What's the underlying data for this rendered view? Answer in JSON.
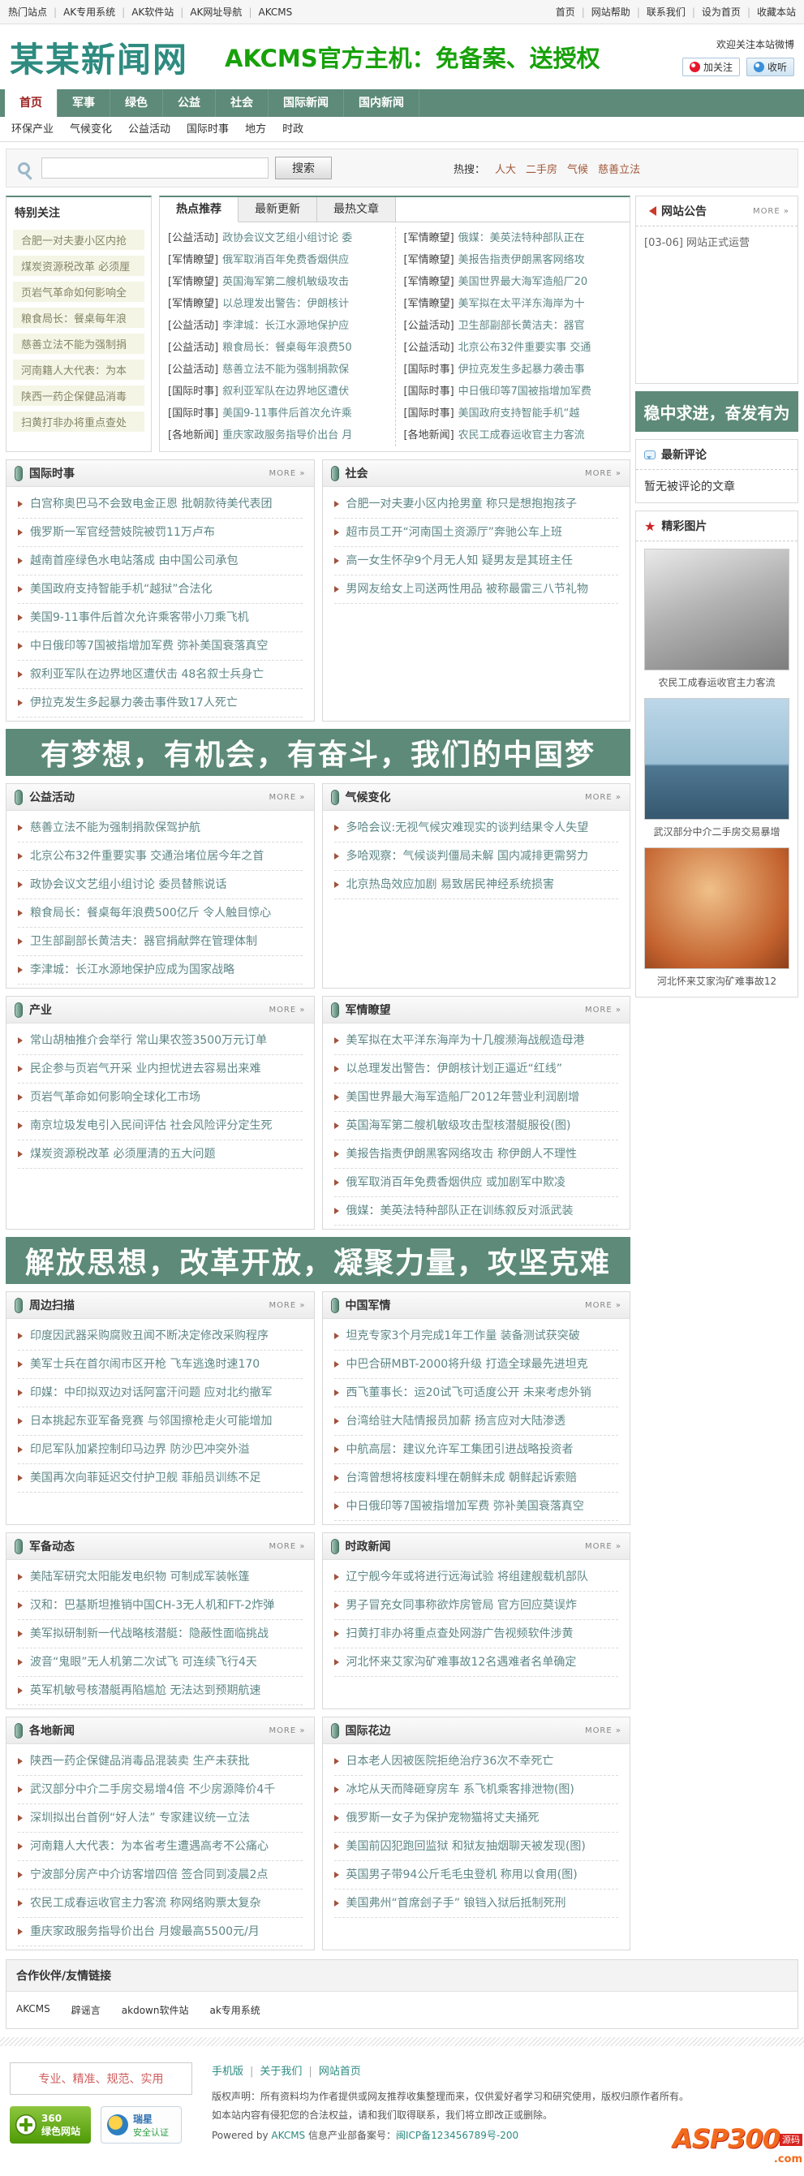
{
  "theme": {
    "accent_green": "#5d8a79",
    "link_teal": "#5e8787",
    "active_red": "#9c1f1f",
    "logo_teal": "#2e8b80",
    "promo_green": "#17a10a"
  },
  "more_label": "MORE »",
  "topbar": {
    "left_links": [
      "热门站点",
      "AK专用系统",
      "AK软件站",
      "AK网址导航",
      "AKCMS"
    ],
    "right_links": [
      "首页",
      "网站帮助",
      "联系我们",
      "设为首页",
      "收藏本站"
    ]
  },
  "header": {
    "site_name": "某某新闻网",
    "promo": "AKCMS官方主机：免备案、送授权",
    "weibo_note": "欢迎关注本站微博",
    "follow_label": "加关注",
    "listen_label": "收听"
  },
  "nav": {
    "items": [
      "首页",
      "军事",
      "绿色",
      "公益",
      "社会",
      "国际新闻",
      "国内新闻"
    ]
  },
  "subnav": {
    "items": [
      "环保产业",
      "气候变化",
      "公益活动",
      "国际时事",
      "地方",
      "时政"
    ]
  },
  "search": {
    "button": "搜索",
    "hot_label": "热搜：",
    "hot_links": [
      "人大",
      "二手房",
      "气候",
      "慈善立法"
    ]
  },
  "special": {
    "title": "特别关注",
    "items": [
      "合肥一对夫妻小区内抢",
      "煤炭资源税改革 必须厘",
      "页岩气革命如何影响全",
      "粮食局长：餐桌每年浪",
      "慈善立法不能为强制捐",
      "河南籍人大代表：为本",
      "陕西一药企保健品消毒",
      "扫黄打非办将重点查处"
    ]
  },
  "tabs": {
    "labels": [
      "热点推荐",
      "最新更新",
      "最热文章"
    ],
    "left": [
      {
        "tag": "[公益活动]",
        "title": "政协会议文艺组小组讨论 委"
      },
      {
        "tag": "[军情瞭望]",
        "title": "俄军取消百年免费香烟供应"
      },
      {
        "tag": "[军情瞭望]",
        "title": "英国海军第二艘机敏级攻击"
      },
      {
        "tag": "[军情瞭望]",
        "title": "以总理发出警告：伊朗核计"
      },
      {
        "tag": "[公益活动]",
        "title": "李津城：长江水源地保护应"
      },
      {
        "tag": "[公益活动]",
        "title": "粮食局长：餐桌每年浪费50"
      },
      {
        "tag": "[公益活动]",
        "title": "慈善立法不能为强制捐款保"
      },
      {
        "tag": "[国际时事]",
        "title": "叙利亚军队在边界地区遭伏"
      },
      {
        "tag": "[国际时事]",
        "title": "美国9-11事件后首次允许乘"
      },
      {
        "tag": "[各地新闻]",
        "title": "重庆家政服务指导价出台 月"
      }
    ],
    "right": [
      {
        "tag": "[军情瞭望]",
        "title": "俄媒：美英法特种部队正在"
      },
      {
        "tag": "[军情瞭望]",
        "title": "美报告指责伊朗黑客网络攻"
      },
      {
        "tag": "[军情瞭望]",
        "title": "美国世界最大海军造船厂20"
      },
      {
        "tag": "[军情瞭望]",
        "title": "美军拟在太平洋东海岸为十"
      },
      {
        "tag": "[公益活动]",
        "title": "卫生部副部长黄洁夫：器官"
      },
      {
        "tag": "[公益活动]",
        "title": "北京公布32件重要实事 交通"
      },
      {
        "tag": "[国际时事]",
        "title": "伊拉克发生多起暴力袭击事"
      },
      {
        "tag": "[国际时事]",
        "title": "中日俄印等7国被指增加军费"
      },
      {
        "tag": "[国际时事]",
        "title": "美国政府支持智能手机“越"
      },
      {
        "tag": "[各地新闻]",
        "title": "农民工成春运收官主力客流"
      }
    ]
  },
  "sidebar": {
    "notice": {
      "title": "网站公告",
      "items": [
        "[03-06] 网站正式运营"
      ]
    },
    "slogan": "稳中求进，奋发有为",
    "comments": {
      "title": "最新评论",
      "empty": "暂无被评论的文章"
    },
    "photos": {
      "title": "精彩图片",
      "items": [
        {
          "caption": "农民工成春运收官主力客流"
        },
        {
          "caption": "武汉部分中介二手房交易暴增"
        },
        {
          "caption": "河北怀来艾家沟矿难事故12"
        }
      ]
    }
  },
  "banners": {
    "banner1": "有梦想，有机会，有奋斗，我们的中国梦",
    "banner2": "解放思想，改革开放，凝聚力量，攻坚克难"
  },
  "sections": {
    "intl": {
      "title": "国际时事",
      "items": [
        "白宫称奥巴马不会致电金正恩 批朝款待美代表团",
        "俄罗斯一军官经营妓院被罚11万卢布",
        "越南首座绿色水电站落成 由中国公司承包",
        "美国政府支持智能手机“越狱”合法化",
        "美国9-11事件后首次允许乘客带小刀乘飞机",
        "中日俄印等7国被指增加军费 弥补美国衰落真空",
        "叙利亚军队在边界地区遭伏击 48名叙士兵身亡",
        "伊拉克发生多起暴力袭击事件致17人死亡"
      ]
    },
    "society": {
      "title": "社会",
      "items": [
        "合肥一对夫妻小区内抢男童 称只是想抱抱孩子",
        "超市员工开“河南国土资源厅”奔驰公车上班",
        "高一女生怀孕9个月无人知 疑男友是其班主任",
        "男网友给女上司送两性用品 被称最雷三八节礼物"
      ]
    },
    "charity": {
      "title": "公益活动",
      "items": [
        "慈善立法不能为强制捐款保驾护航",
        "北京公布32件重要实事 交通治堵位居今年之首",
        "政协会议文艺组小组讨论 委员替熊说话",
        "粮食局长：餐桌每年浪费500亿斤 令人触目惊心",
        "卫生部副部长黄洁夫：器官捐献弊在管理体制",
        "李津城：长江水源地保护应成为国家战略"
      ]
    },
    "climate": {
      "title": "气候变化",
      "items": [
        "多哈会议:无视气候灾难现实的谈判结果令人失望",
        "多哈观察：气候谈判僵局未解 国内减排更需努力",
        "北京热岛效应加剧 易致居民神经系统损害"
      ]
    },
    "industry": {
      "title": "产业",
      "items": [
        "常山胡柚推介会举行 常山果农签3500万元订单",
        "民企参与页岩气开采 业内担忧进去容易出来难",
        "页岩气革命如何影响全球化工市场",
        "南京垃圾发电引入民间评估 社会风险评分定生死",
        "煤炭资源税改革 必须厘清的五大问题"
      ]
    },
    "military_watch": {
      "title": "军情瞭望",
      "items": [
        "美军拟在太平洋东海岸为十几艘濒海战舰造母港",
        "以总理发出警告：伊朗核计划正逼近“红线”",
        "美国世界最大海军造船厂2012年营业利润剧增",
        "英国海军第二艘机敏级攻击型核潜艇服役(图)",
        "美报告指责伊朗黑客网络攻击 称伊朗人不理性",
        "俄军取消百年免费香烟供应 或加剧军中欺凌",
        "俄媒：美英法特种部队正在训练叙反对派武装"
      ]
    },
    "periphery": {
      "title": "周边扫描",
      "items": [
        "印度因武器采购腐败丑闻不断决定修改采购程序",
        "美军士兵在首尔闹市区开枪 飞车逃逸时速170",
        "印媒：中印拟双边对话阿富汗问题 应对北约撤军",
        "日本挑起东亚军备竞赛 与邻国擦枪走火可能增加",
        "印尼军队加紧控制印马边界 防沙巴冲突外溢",
        "美国再次向菲延迟交付护卫舰 菲船员训练不足"
      ]
    },
    "china_military": {
      "title": "中国军情",
      "items": [
        "坦克专家3个月完成1年工作量 装备测试获突破",
        "中巴合研MBT-2000将升级 打造全球最先进坦克",
        "西飞董事长：运20试飞可适度公开 未来考虑外销",
        "台湾给驻大陆情报员加薪 扬言应对大陆渗透",
        "中航高层：建议允许军工集团引进战略投资者",
        "台湾曾想将核废料埋在朝鲜未成 朝鲜起诉索赔",
        "中日俄印等7国被指增加军费 弥补美国衰落真空"
      ]
    },
    "arms": {
      "title": "军备动态",
      "items": [
        "美陆军研究太阳能发电织物 可制成军装帐篷",
        "汉和：巴基斯坦推销中国CH-3无人机和FT-2炸弹",
        "美军拟研制新一代战略核潜艇：隐蔽性面临挑战",
        "波音“鬼眼”无人机第二次试飞 可连续飞行4天",
        "英军机敏号核潜艇再陷尴尬 无法达到预期航速"
      ]
    },
    "politics": {
      "title": "时政新闻",
      "items": [
        "辽宁舰今年或将进行远海试验 将组建舰载机部队",
        "男子冒充女同事称欲炸房管局 官方回应莫误炸",
        "扫黄打非办将重点查处网游广告视频软件涉黄",
        "河北怀来艾家沟矿难事故12名遇难者名单确定"
      ]
    },
    "local": {
      "title": "各地新闻",
      "items": [
        "陕西一药企保健品消毒品混装卖 生产未获批",
        "武汉部分中介二手房交易增4倍 不少房源降价4千",
        "深圳拟出台首例“好人法” 专家建议统一立法",
        "河南籍人大代表：为本省考生遭遇高考不公痛心",
        "宁波部分房产中介访客增四倍 签合同到凌晨2点",
        "农民工成春运收官主力客流 称网络购票太复杂",
        "重庆家政服务指导价出台 月嫂最高5500元/月"
      ]
    },
    "intl_fun": {
      "title": "国际花边",
      "items": [
        "日本老人因被医院拒绝治疗36次不幸死亡",
        "冰坨从天而降砸穿房车 系飞机乘客排泄物(图)",
        "俄罗斯一女子为保护宠物猫将丈夫捅死",
        "美国前囚犯跑回监狱 和狱友抽烟聊天被发现(图)",
        "英国男子带94公斤毛毛虫登机 称用以食用(图)",
        "美国弗州“首席刽子手” 锒铛入狱后抵制死刑"
      ]
    }
  },
  "friends": {
    "title": "合作伙伴/友情链接",
    "links": [
      "AKCMS",
      "辟谣言",
      "akdown软件站",
      "ak专用系统"
    ]
  },
  "footer": {
    "slogan": "专业、精准、规范、实用",
    "badge_360_line1": "360",
    "badge_360_line2": "绿色网站",
    "badge_rising_line1": "瑞星",
    "badge_rising_line2": "安全认证",
    "links": [
      "手机版",
      "关于我们",
      "网站首页"
    ],
    "copyright1": "版权声明：所有资料均为作者提供或网友推荐收集整理而来，仅供爱好者学习和研究使用，版权归原作者所有。",
    "copyright2": "如本站内容有侵犯您的合法权益，请和我们取得联系，我们将立即改正或删除。",
    "powered_prefix": "Powered by",
    "powered_link": "AKCMS",
    "icp_prefix": "信息产业部备案号：",
    "icp_number": "闽ICP备123456789号-200",
    "watermark_main": "ASP300",
    "watermark_tag": "源码",
    "watermark_suffix": ".com"
  }
}
